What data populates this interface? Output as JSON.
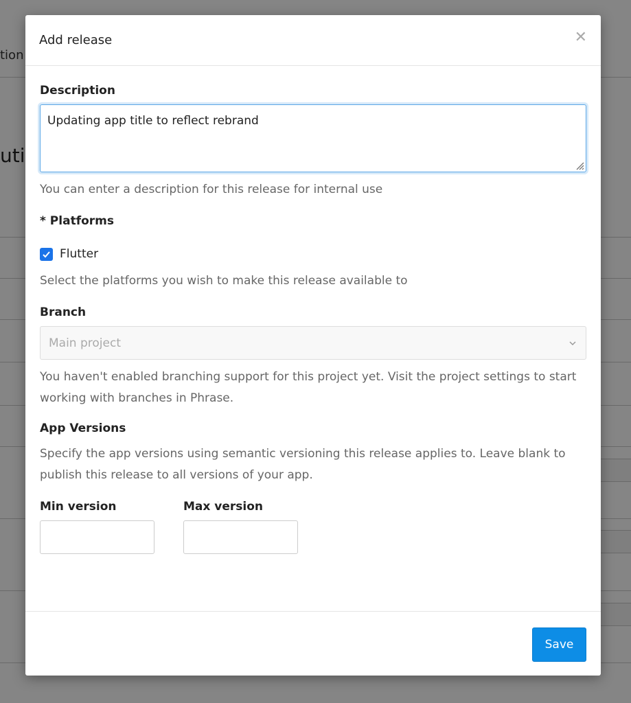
{
  "background": {
    "partial_text_1": "tion",
    "partial_text_2": "uti"
  },
  "modal": {
    "title": "Add release",
    "close_icon": "close-icon",
    "description": {
      "label": "Description",
      "value": "Updating app title to reflect rebrand",
      "help": "You can enter a description for this release for internal use"
    },
    "platforms": {
      "label": "* Platforms",
      "options": [
        {
          "label": "Flutter",
          "checked": true
        }
      ],
      "help": "Select the platforms you wish to make this release available to"
    },
    "branch": {
      "label": "Branch",
      "value": "Main project",
      "disabled": true,
      "help": "You haven't enabled branching support for this project yet. Visit the project settings to start working with branches in Phrase."
    },
    "app_versions": {
      "label": "App Versions",
      "help": "Specify the app versions using semantic versioning this release applies to. Leave blank to publish this release to all versions of your app.",
      "min_label": "Min version",
      "min_value": "",
      "max_label": "Max version",
      "max_value": ""
    },
    "footer": {
      "save_label": "Save"
    }
  },
  "colors": {
    "accent": "#0d8de6",
    "checkbox": "#1a73e8",
    "focus_border": "#5aa6e6"
  }
}
